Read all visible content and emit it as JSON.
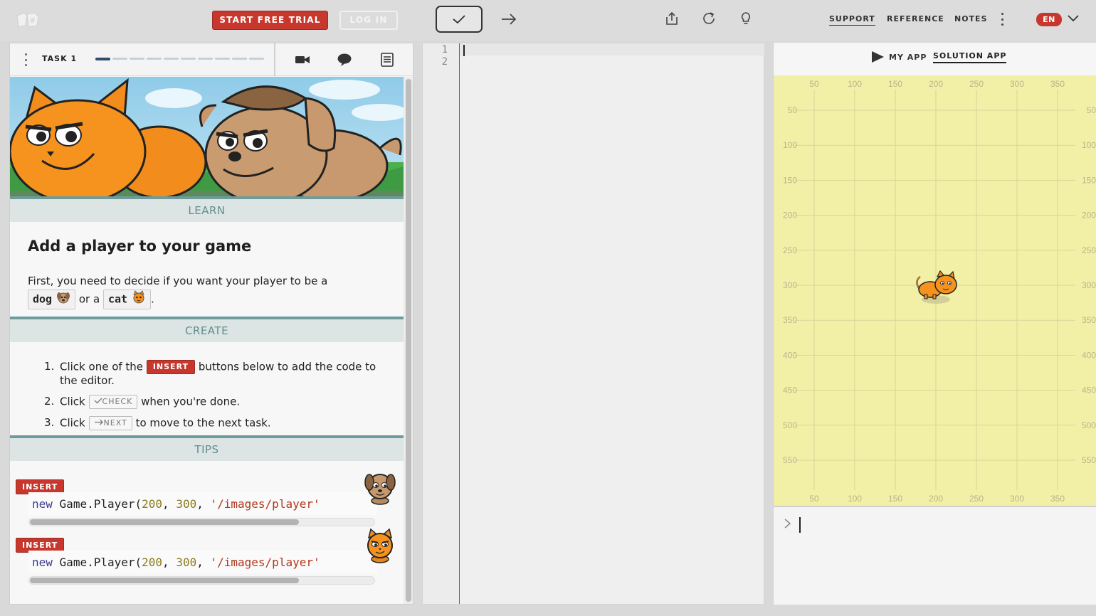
{
  "topbar": {
    "start_trial_label": "START FREE TRIAL",
    "login_label": "LOG IN",
    "nav": {
      "support": "SUPPORT",
      "reference": "REFERENCE",
      "notes": "NOTES"
    },
    "language": "EN",
    "colors": {
      "accent_red": "#c8372d"
    }
  },
  "task": {
    "label": "TASK 1",
    "progress_total": 10,
    "progress_current": 1
  },
  "learn": {
    "section": "LEARN",
    "title": "Add a player to your game",
    "text_before": "First, you need to decide if you want your player to be a",
    "option_dog": "dog",
    "text_or": "or a",
    "option_cat": "cat",
    "text_end": "."
  },
  "create": {
    "section": "CREATE",
    "steps": [
      {
        "num": "1.",
        "before": "Click one of the",
        "badge": "INSERT",
        "after": "buttons below to add the code to the editor."
      },
      {
        "num": "2.",
        "before": "Click",
        "badge": "CHECK",
        "after": "when you're done."
      },
      {
        "num": "3.",
        "before": "Click",
        "badge": "NEXT",
        "after": "to move to the next task."
      }
    ]
  },
  "tips": {
    "section": "TIPS",
    "items": [
      {
        "insert_label": "INSERT",
        "kw": "new",
        "call": "Game.Player(",
        "n1": "200",
        "sep1": ", ",
        "n2": "300",
        "sep2": ", ",
        "str": "'/images/player'",
        "avatar": "dog-face-icon"
      },
      {
        "insert_label": "INSERT",
        "kw": "new",
        "call": "Game.Player(",
        "n1": "200",
        "sep1": ", ",
        "n2": "300",
        "sep2": ", ",
        "str": "'/images/player'",
        "avatar": "cat-face-icon"
      }
    ]
  },
  "editor": {
    "line_numbers": [
      "1",
      "2"
    ]
  },
  "preview": {
    "tab_my_app": "MY APP",
    "tab_solution_app": "SOLUTION APP",
    "x_ticks": [
      "50",
      "100",
      "150",
      "200",
      "250",
      "300",
      "350"
    ],
    "y_ticks": [
      "50",
      "100",
      "150",
      "200",
      "250",
      "300",
      "350",
      "400",
      "450",
      "500",
      "550"
    ],
    "player_position": [
      200,
      300
    ],
    "canvas_color": "#f2f0a7"
  }
}
